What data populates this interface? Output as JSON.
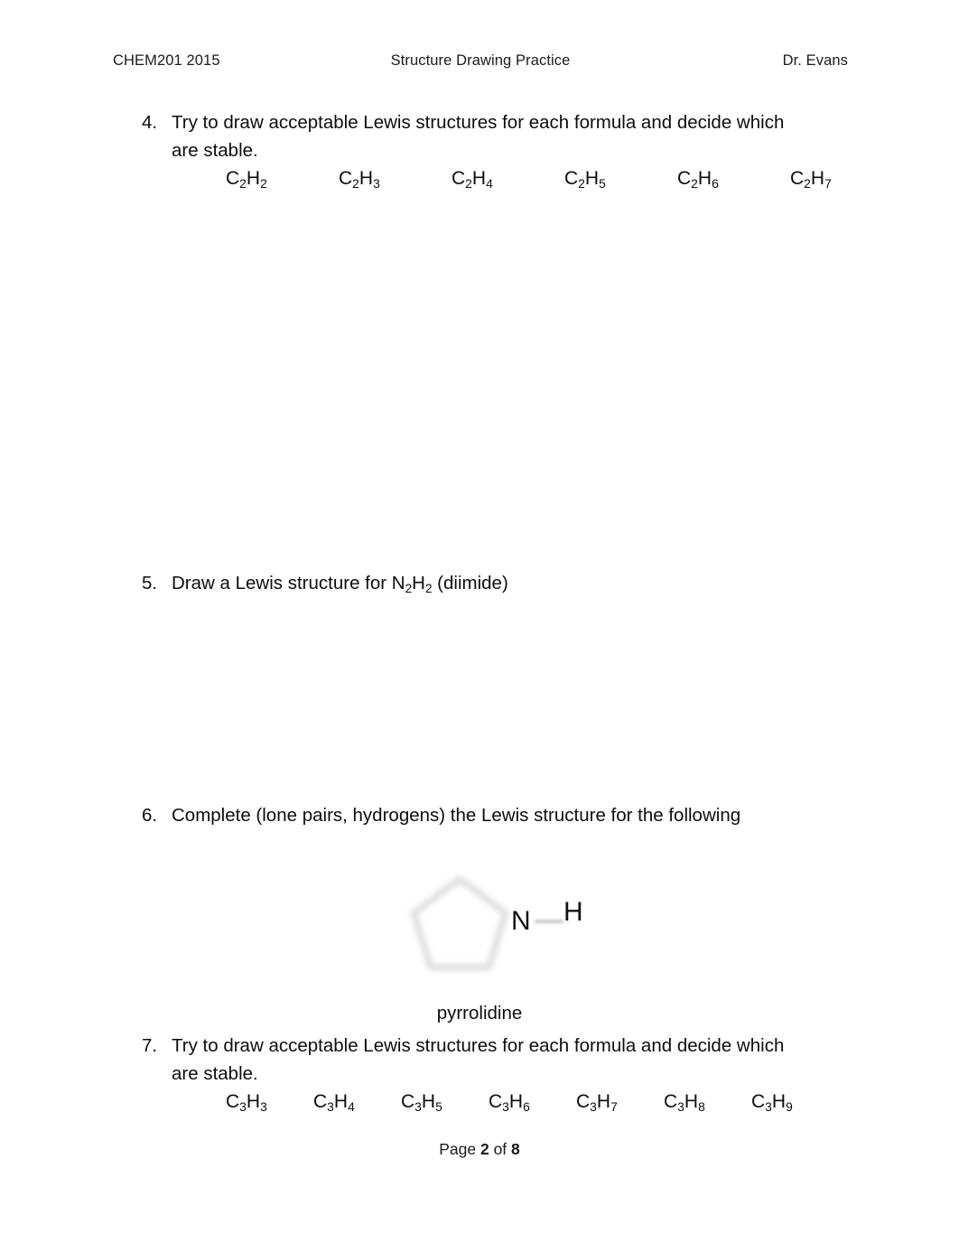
{
  "header": {
    "left": "CHEM201 2015",
    "center": "Structure Drawing Practice",
    "right": "Dr. Evans"
  },
  "questions": [
    {
      "number": "4.",
      "line1": "Try to draw acceptable Lewis structures for each formula and decide which",
      "line2": "are stable."
    },
    {
      "number": "5.",
      "prefix": "Draw a Lewis structure for N",
      "sub1": "2",
      "mid": "H",
      "sub2": "2",
      "suffix": " (diimide)"
    },
    {
      "number": "6.",
      "line1": "Complete (lone pairs, hydrogens) the Lewis structure for the following"
    },
    {
      "number": "7.",
      "line1": "Try to draw acceptable Lewis structures for each formula and decide which",
      "line2": "are stable."
    }
  ],
  "formulas_q4": [
    {
      "element": "C",
      "sub_c": "2",
      "hydrogen": "H",
      "sub_h": "2"
    },
    {
      "element": "C",
      "sub_c": "2",
      "hydrogen": "H",
      "sub_h": "3"
    },
    {
      "element": "C",
      "sub_c": "2",
      "hydrogen": "H",
      "sub_h": "4"
    },
    {
      "element": "C",
      "sub_c": "2",
      "hydrogen": "H",
      "sub_h": "5"
    },
    {
      "element": "C",
      "sub_c": "2",
      "hydrogen": "H",
      "sub_h": "6"
    },
    {
      "element": "C",
      "sub_c": "2",
      "hydrogen": "H",
      "sub_h": "7"
    }
  ],
  "formulas_q7": [
    {
      "element": "C",
      "sub_c": "3",
      "hydrogen": "H",
      "sub_h": "3"
    },
    {
      "element": "C",
      "sub_c": "3",
      "hydrogen": "H",
      "sub_h": "4"
    },
    {
      "element": "C",
      "sub_c": "3",
      "hydrogen": "H",
      "sub_h": "5"
    },
    {
      "element": "C",
      "sub_c": "3",
      "hydrogen": "H",
      "sub_h": "6"
    },
    {
      "element": "C",
      "sub_c": "3",
      "hydrogen": "H",
      "sub_h": "7"
    },
    {
      "element": "C",
      "sub_c": "3",
      "hydrogen": "H",
      "sub_h": "8"
    },
    {
      "element": "C",
      "sub_c": "3",
      "hydrogen": "H",
      "sub_h": "9"
    }
  ],
  "structure": {
    "name": "pyrrolidine",
    "atom_n": "N",
    "atom_h": "H",
    "ring_color": "#d8d8d8",
    "bond_color": "#c9c9c9"
  },
  "footer": {
    "prefix": "Page ",
    "current_page": "2",
    "middle": " of ",
    "total_pages": "8"
  },
  "colors": {
    "page_background": "#ffffff",
    "text": "#0d0d0d",
    "header_text": "#1a1a1a"
  }
}
